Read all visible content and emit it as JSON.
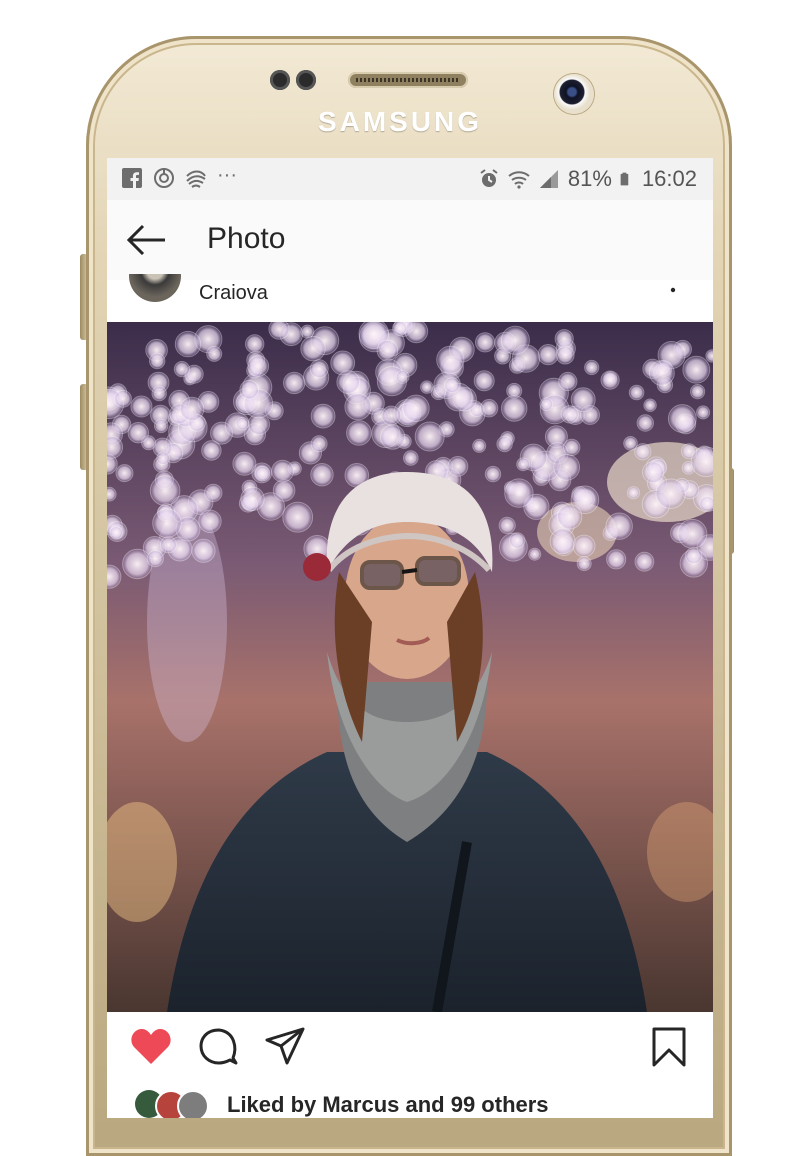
{
  "device": {
    "brand": "SAMSUNG"
  },
  "status_bar": {
    "left_icons": [
      "facebook-icon",
      "sync-icon",
      "cast-icon",
      "more-notifications-icon"
    ],
    "more": "···",
    "battery": "81%",
    "time": "16:02"
  },
  "app_bar": {
    "title": "Photo",
    "back_icon": "arrow-left-icon"
  },
  "post": {
    "location": "Craiova",
    "photo_alt": "Woman in a knit hat and glasses looking up at bokeh string lights",
    "liked": true,
    "like_color": "#ed4956",
    "likes_text": "Liked by Marcus and 99 others"
  },
  "actions": [
    "heart-icon",
    "comment-icon",
    "share-icon",
    "bookmark-icon"
  ]
}
